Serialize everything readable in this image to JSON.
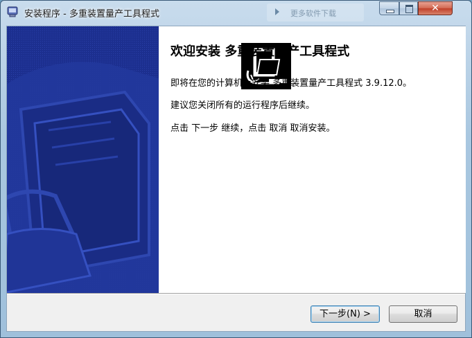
{
  "window": {
    "title": "安装程序 - 多重装置量产工具程式",
    "background_window_title": "更多软件下载",
    "close_symbol": "✕"
  },
  "content": {
    "heading": "欢迎安装 多重装置量产工具程式",
    "line1": "即将在您的计算机上安装 多重装置量产工具程式 3.9.12.0。",
    "line2": "建议您关闭所有的运行程序后继续。",
    "line3": "点击 下一步 继续，点击 取消 取消安装。"
  },
  "buttons": {
    "next": "下一步(N) >",
    "cancel": "取消"
  },
  "colors": {
    "banner": "#1c2f8f",
    "content_background": "#ffffff"
  }
}
